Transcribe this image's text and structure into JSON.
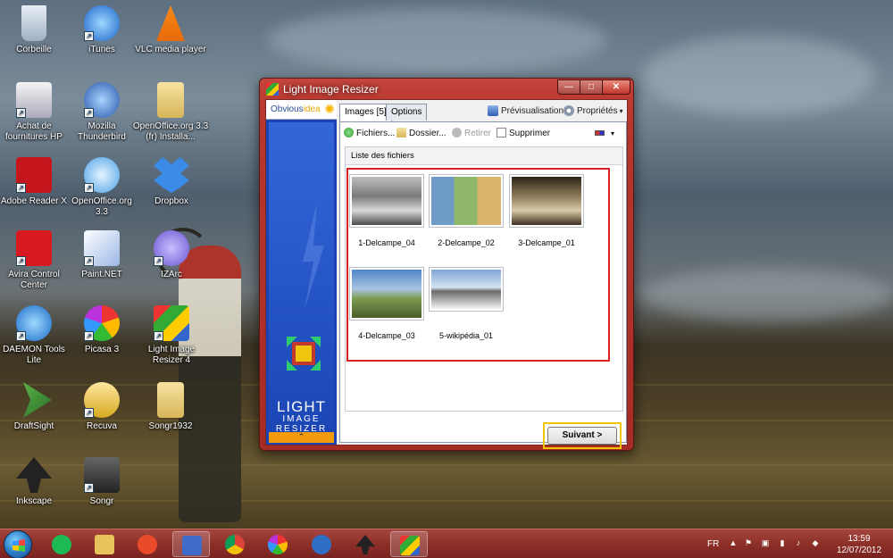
{
  "desktop": {
    "icons": [
      {
        "label": "Corbeille",
        "icon": "recycle-bin-icon"
      },
      {
        "label": "iTunes",
        "icon": "itunes-icon"
      },
      {
        "label": "VLC media player",
        "icon": "vlc-icon"
      },
      {
        "label": "Achat de fournitures HP",
        "icon": "hp-printer-icon"
      },
      {
        "label": "Mozilla Thunderbird",
        "icon": "thunderbird-icon"
      },
      {
        "label": "OpenOffice.org 3.3 (fr) Installa...",
        "icon": "folder-icon"
      },
      {
        "label": "Adobe Reader X",
        "icon": "adobe-reader-icon"
      },
      {
        "label": "OpenOffice.org 3.3",
        "icon": "openoffice-icon"
      },
      {
        "label": "Dropbox",
        "icon": "dropbox-icon"
      },
      {
        "label": "Avira Control Center",
        "icon": "avira-icon"
      },
      {
        "label": "Paint.NET",
        "icon": "paintnet-icon"
      },
      {
        "label": "IZArc",
        "icon": "izarc-icon"
      },
      {
        "label": "DAEMON Tools Lite",
        "icon": "daemon-tools-icon"
      },
      {
        "label": "Picasa 3",
        "icon": "picasa-icon"
      },
      {
        "label": "Light Image Resizer 4",
        "icon": "light-image-resizer-icon"
      },
      {
        "label": "DraftSight",
        "icon": "draftsight-icon"
      },
      {
        "label": "Recuva",
        "icon": "recuva-icon"
      },
      {
        "label": "Songr1932",
        "icon": "folder-icon"
      },
      {
        "label": "Inkscape",
        "icon": "inkscape-icon"
      },
      {
        "label": "Songr",
        "icon": "songr-icon"
      }
    ]
  },
  "window": {
    "title": "Light Image Resizer",
    "controls": {
      "minimize": "—",
      "maximize": "□",
      "close": "✕"
    },
    "sidebar": {
      "logo_part1": "Obvious",
      "logo_part2": "idea",
      "brand_line1": "LIGHT",
      "brand_line2": "IMAGE",
      "brand_line3": "RESIZER",
      "collapse": "⌃"
    },
    "tabs": [
      {
        "label": "Images [5]",
        "active": true
      },
      {
        "label": "Options",
        "active": false
      }
    ],
    "tab_actions": {
      "preview": "Prévisualisation",
      "properties": "Propriétés",
      "dropdown": "▾"
    },
    "toolbar": {
      "files": "Fichiers...",
      "folder": "Dossier...",
      "remove": "Retirer",
      "delete": "Supprimer",
      "view_dropdown": "▾"
    },
    "list": {
      "header": "Liste des fichiers",
      "items": [
        {
          "name": "1-Delcampe_04"
        },
        {
          "name": "2-Delcampe_02"
        },
        {
          "name": "3-Delcampe_01"
        },
        {
          "name": "4-Delcampe_03"
        },
        {
          "name": "5-wikipédia_01"
        }
      ]
    },
    "next_button": "Suivant >"
  },
  "taskbar": {
    "items": [
      {
        "icon": "spotify-icon",
        "color": "#1db954"
      },
      {
        "icon": "explorer-folder-icon",
        "color": "#e8c25a"
      },
      {
        "icon": "headphones-icon",
        "color": "#e84a2a"
      },
      {
        "icon": "paintnet-icon",
        "color": "#3d6bc7"
      },
      {
        "icon": "chrome-icon",
        "color": "#e5c133"
      },
      {
        "icon": "picasa-icon",
        "color": "#d04bd0"
      },
      {
        "icon": "thunderbird-icon",
        "color": "#2f6ec2"
      },
      {
        "icon": "inkscape-icon",
        "color": "#222222"
      },
      {
        "icon": "light-image-resizer-icon",
        "color": "#e23a2a"
      }
    ],
    "language": "FR",
    "time": "13:59",
    "date": "12/07/2012"
  }
}
